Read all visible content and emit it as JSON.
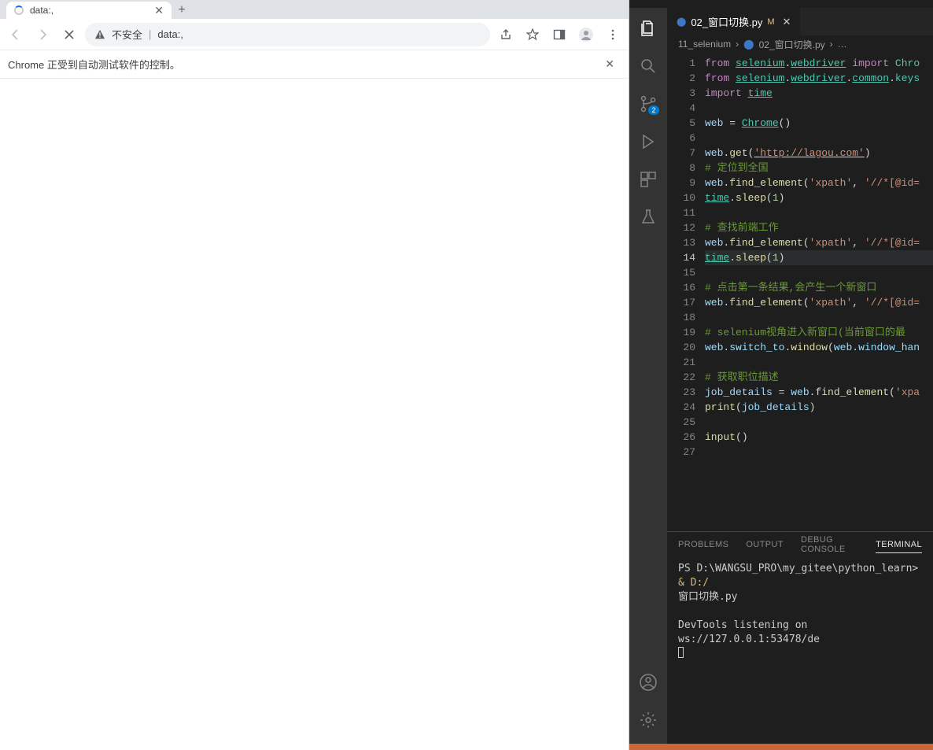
{
  "chrome": {
    "tab_title": "data:,",
    "address_warn": "不安全",
    "address_value": "data:,",
    "infobar_text": "Chrome 正受到自动测试软件的控制。"
  },
  "vscode": {
    "tab": {
      "filename": "02_窗口切换.py",
      "modified_badge": "M"
    },
    "breadcrumb": {
      "folder": "11_selenium",
      "file": "02_窗口切换.py",
      "more": "…"
    },
    "activity_badge": "2",
    "code": {
      "l1": {
        "a": "from",
        "b": "selenium",
        "c": "webdriver",
        "d": "import",
        "e": "Chro"
      },
      "l2": {
        "a": "from",
        "b": "selenium",
        "c": "webdriver",
        "d": "common",
        "e": "keys"
      },
      "l3": {
        "a": "import",
        "b": "time"
      },
      "l5": {
        "a": "web",
        "b": "=",
        "c": "Chrome",
        "d": "()"
      },
      "l7": {
        "a": "web",
        "b": "get",
        "c": "'http://lagou.com'"
      },
      "l8": "# 定位到全国",
      "l9": {
        "a": "web",
        "b": "find_element",
        "c": "'xpath'",
        "d": "'//*[@id="
      },
      "l10": {
        "a": "time",
        "b": "sleep",
        "c": "1"
      },
      "l12": "# 查找前端工作",
      "l13": {
        "a": "web",
        "b": "find_element",
        "c": "'xpath'",
        "d": "'//*[@id="
      },
      "l14": {
        "a": "time",
        "b": "sleep",
        "c": "1"
      },
      "l16": "# 点击第一条结果,会产生一个新窗口",
      "l17": {
        "a": "web",
        "b": "find_element",
        "c": "'xpath'",
        "d": "'//*[@id="
      },
      "l19": "# selenium视角进入新窗口(当前窗口的最",
      "l20": {
        "a": "web",
        "b": "switch_to",
        "c": "window",
        "d": "web",
        "e": "window_han"
      },
      "l22": "# 获取职位描述",
      "l23": {
        "a": "job_details",
        "b": "=",
        "c": "web",
        "d": "find_element",
        "e": "'xpa"
      },
      "l24": {
        "a": "print",
        "b": "job_details"
      },
      "l26": {
        "a": "input",
        "b": "()"
      }
    },
    "line_numbers": [
      "1",
      "2",
      "3",
      "4",
      "5",
      "6",
      "7",
      "8",
      "9",
      "10",
      "11",
      "12",
      "13",
      "14",
      "15",
      "16",
      "17",
      "18",
      "19",
      "20",
      "21",
      "22",
      "23",
      "24",
      "25",
      "26",
      "27"
    ],
    "panel_tabs": {
      "problems": "PROBLEMS",
      "output": "OUTPUT",
      "debug": "DEBUG CONSOLE",
      "terminal": "TERMINAL"
    },
    "terminal": {
      "line1_prefix": "PS D:\\WANGSU_PRO\\my_gitee\\python_learn> ",
      "line1_cmd": "& D:/",
      "line2": "窗口切换.py",
      "line4": "DevTools listening on ws://127.0.0.1:53478/de"
    }
  }
}
